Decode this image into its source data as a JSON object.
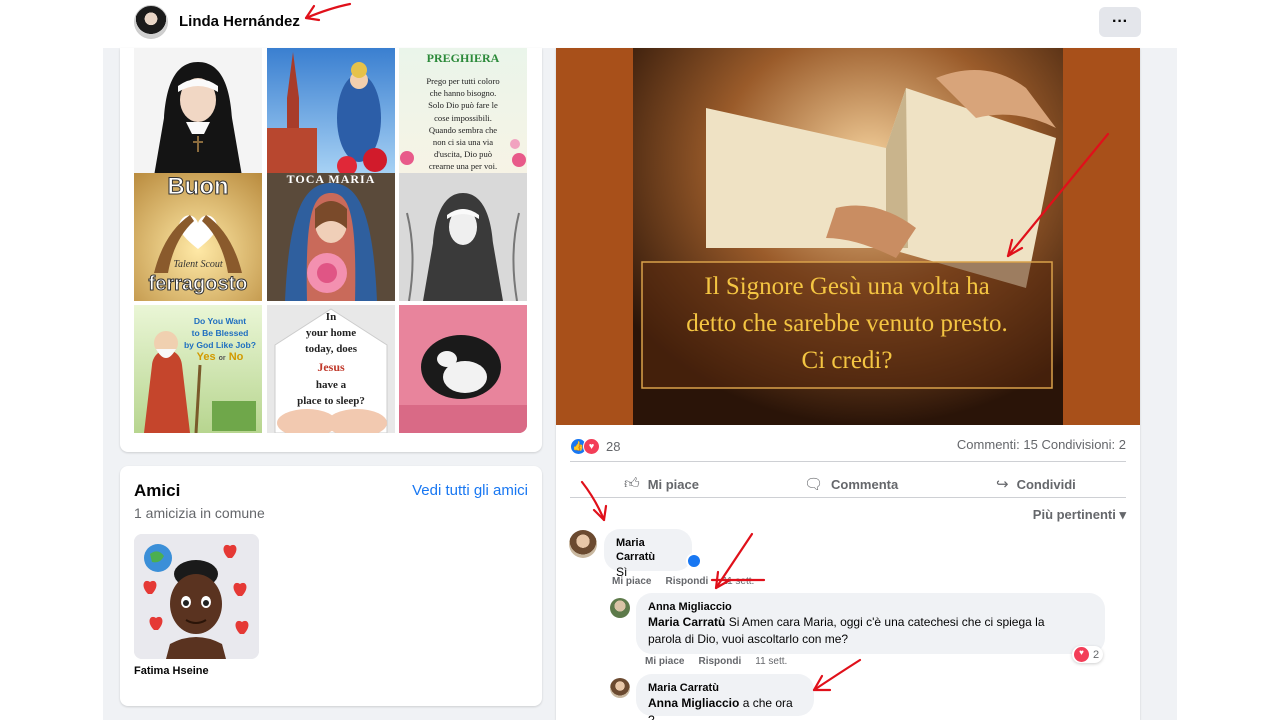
{
  "header": {
    "profile_name": "Linda Hernández",
    "more_label": "···"
  },
  "photos": {
    "tile3": {
      "title": "PREGHIERA",
      "lines": [
        "Prego per tutti coloro",
        "che hanno bisogno.",
        "Solo Dio può fare le",
        "cose impossibili.",
        "Quando sembra che",
        "non ci sia una via",
        "d'uscita, Dio può",
        "crearne una per voi."
      ]
    },
    "tile4": {
      "top": "Buon",
      "script": "Talent Scout",
      "bottom": "ferragosto"
    },
    "tile5": {
      "title": "TOCA MARIA"
    },
    "tile7": {
      "line1": "Do You Want",
      "line2": "to Be Blessed",
      "line3": "by God Like Job?",
      "yes": "Yes",
      "or": "or",
      "no": "No"
    },
    "tile8": {
      "lines": [
        "In",
        "your home",
        "today, does"
      ],
      "jesus": "Jesus",
      "lines2": [
        "have a",
        "place to sleep?"
      ]
    }
  },
  "friends": {
    "title": "Amici",
    "see_all": "Vedi tutti gli amici",
    "mutual": "1 amicizia in comune",
    "items": [
      {
        "name": "Fatima Hseine"
      }
    ]
  },
  "post": {
    "image_text": [
      "Il Signore Gesù una volta ha",
      "detto che sarebbe venuto presto.",
      "Ci credi?"
    ],
    "reaction_count": "28",
    "counts": "Commenti: 15  Condivisioni: 2",
    "actions": {
      "like": "Mi piace",
      "comment": "Commenta",
      "share": "Condividi"
    },
    "sort_label": "Più pertinenti"
  },
  "comments": [
    {
      "author": "Maria Carratù",
      "text": "Sì",
      "like": "Mi piace",
      "reply": "Rispondi",
      "time": "11 sett."
    },
    {
      "author": "Anna Migliaccio",
      "mention": "Maria Carratù",
      "text": " Si Amen cara Maria, oggi c'è una catechesi che ci spiega la",
      "text2": "parola di Dio, vuoi ascoltarlo con me?",
      "like": "Mi piace",
      "reply": "Rispondi",
      "time": "11 sett.",
      "reactions": "2"
    },
    {
      "author": "Maria Carratù",
      "mention": "Anna Migliaccio",
      "text": " a che ora ?"
    }
  ],
  "colors": {
    "link": "#1877f2",
    "annotation": "#e0101a",
    "post_bg": "#a8501a"
  }
}
